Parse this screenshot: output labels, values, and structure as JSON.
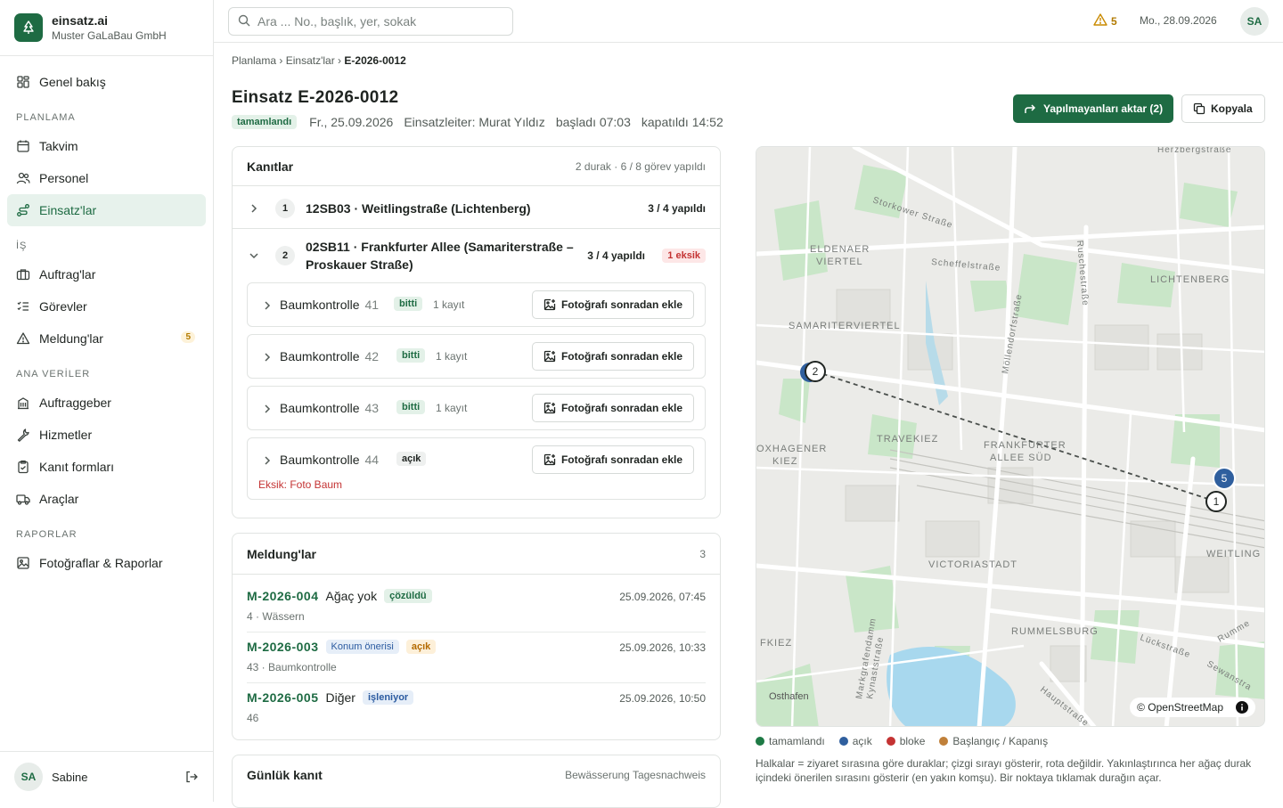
{
  "brand": {
    "name": "einsatz.ai",
    "company": "Muster GaLaBau GmbH"
  },
  "nav": {
    "overview": "Genel bakış",
    "sec_planning": "PLANLAMA",
    "calendar": "Takvim",
    "staff": "Personel",
    "deployments": "Einsatz'lar",
    "sec_work": "İŞ",
    "orders": "Auftrag'lar",
    "tasks": "Görevler",
    "reports_meld": "Meldung'lar",
    "reports_meld_badge": "5",
    "sec_master": "ANA VERİLER",
    "clients": "Auftraggeber",
    "services": "Hizmetler",
    "evidence_forms": "Kanıt formları",
    "vehicles": "Araçlar",
    "sec_reports": "RAPORLAR",
    "photos_reports": "Fotoğraflar & Raporlar"
  },
  "user": {
    "initials": "SA",
    "name": "Sabine"
  },
  "topbar": {
    "search_placeholder": "Ara ... No., başlık, yer, sokak",
    "warn_count": "5",
    "date": "Mo., 28.09.2026",
    "initials": "SA"
  },
  "breadcrumb": {
    "a": "Planlama",
    "sep": "›",
    "b": "Einsatz'lar",
    "c": "E-2026-0012"
  },
  "header": {
    "title": "Einsatz E-2026-0012",
    "status": "tamamlandı",
    "date": "Fr., 25.09.2026",
    "leader": "Einsatzleiter: Murat Yıldız",
    "started": "başladı 07:03",
    "closed": "kapatıldı 14:52",
    "transfer_label": "Yapılmayanları aktar (2)",
    "copy_label": "Kopyala"
  },
  "evidence": {
    "title": "Kanıtlar",
    "summary": "2 durak · 6 / 8 görev yapıldı",
    "stops": [
      {
        "num": "1",
        "label": "12SB03 · Weitlingstraße (Lichtenberg)",
        "done": "3 / 4 yapıldı"
      },
      {
        "num": "2",
        "label_l1": "02SB11 · Frankfurter Allee (Samariterstraße –",
        "label_l2": "Proskauer Straße)",
        "done": "3 / 4 yapıldı",
        "missing": "1 eksik"
      }
    ],
    "tasks": [
      {
        "name": "Baumkontrolle",
        "num": "41",
        "status": "bitti",
        "records": "1 kayıt",
        "button": "Fotoğrafı sonradan ekle"
      },
      {
        "name": "Baumkontrolle",
        "num": "42",
        "status": "bitti",
        "records": "1 kayıt",
        "button": "Fotoğrafı sonradan ekle"
      },
      {
        "name": "Baumkontrolle",
        "num": "43",
        "status": "bitti",
        "records": "1 kayıt",
        "button": "Fotoğrafı sonradan ekle"
      },
      {
        "name": "Baumkontrolle",
        "num": "44",
        "status": "açık",
        "records": "",
        "button": "Fotoğrafı sonradan ekle",
        "missing": "Eksik: Foto Baum"
      }
    ]
  },
  "meldungen": {
    "title": "Meldung'lar",
    "count": "3",
    "items": [
      {
        "id": "M-2026-004",
        "title": "Ağaç yok",
        "tags": [
          "çözüldü"
        ],
        "sub": "4 · Wässern",
        "date": "25.09.2026, 07:45"
      },
      {
        "id": "M-2026-003",
        "title": "",
        "tags": [
          "Konum önerisi",
          "açık"
        ],
        "sub": "43 · Baumkontrolle",
        "date": "25.09.2026, 10:33"
      },
      {
        "id": "M-2026-005",
        "title": "Diğer",
        "tags": [
          "işleniyor"
        ],
        "sub": "46",
        "date": "25.09.2026, 10:50"
      }
    ]
  },
  "daily": {
    "title": "Günlük kanıt",
    "sub": "Bewässerung Tagesnachweis"
  },
  "map": {
    "labels": {
      "herzberg": "Herzbergstraße",
      "storkower": "Storkower Straße",
      "eldenaer1": "ELDENAER",
      "eldenaer2": "VIERTEL",
      "scheffel": "Scheffelstraße",
      "rusche": "Ruschestraße",
      "lichtenberg": "LICHTENBERG",
      "samariter": "SAMARITERVIERTEL",
      "moellendorf": "Möllendorfstraße",
      "oxhagener1": "OXHAGENER",
      "oxhagener2": "KIEZ",
      "travekiez": "TRAVEKIEZ",
      "frankfurter1": "FRANKFURTER",
      "frankfurter2": "ALLEE SÜD",
      "weitling": "WEITLING",
      "victoria": "VICTORIASTADT",
      "fkiez": "FKIEZ",
      "markgrafen": "Markgrafendamm",
      "kynast": "Kynaststraße",
      "rummelsburg": "RUMMELSBURG",
      "lueckstr": "Lückstraße",
      "rumme": "Rumme",
      "sewanstr": "Sewanstra",
      "hauptstr": "Hauptstraße",
      "osthafen": "Osthafen"
    },
    "markers": [
      {
        "num": "2"
      },
      {
        "num": "5"
      },
      {
        "num": "1"
      }
    ],
    "attribution": "© OpenStreetMap"
  },
  "legend": {
    "done": "tamamlandı",
    "open": "açık",
    "blocked": "bloke",
    "startend": "Başlangıç / Kapanış"
  },
  "map_note": "Halkalar = ziyaret sırasına göre duraklar; çizgi sırayı gösterir, rota değildir. Yakınlaştırınca her ağaç durak içindeki önerilen sırasını gösterir (en yakın komşu). Bir noktaya tıklamak durağın açar.",
  "colors": {
    "accent": "#1e6b43",
    "done": "#1e7a45",
    "open": "#2f5f9e",
    "blocked": "#c43333",
    "startend": "#c0803a"
  }
}
